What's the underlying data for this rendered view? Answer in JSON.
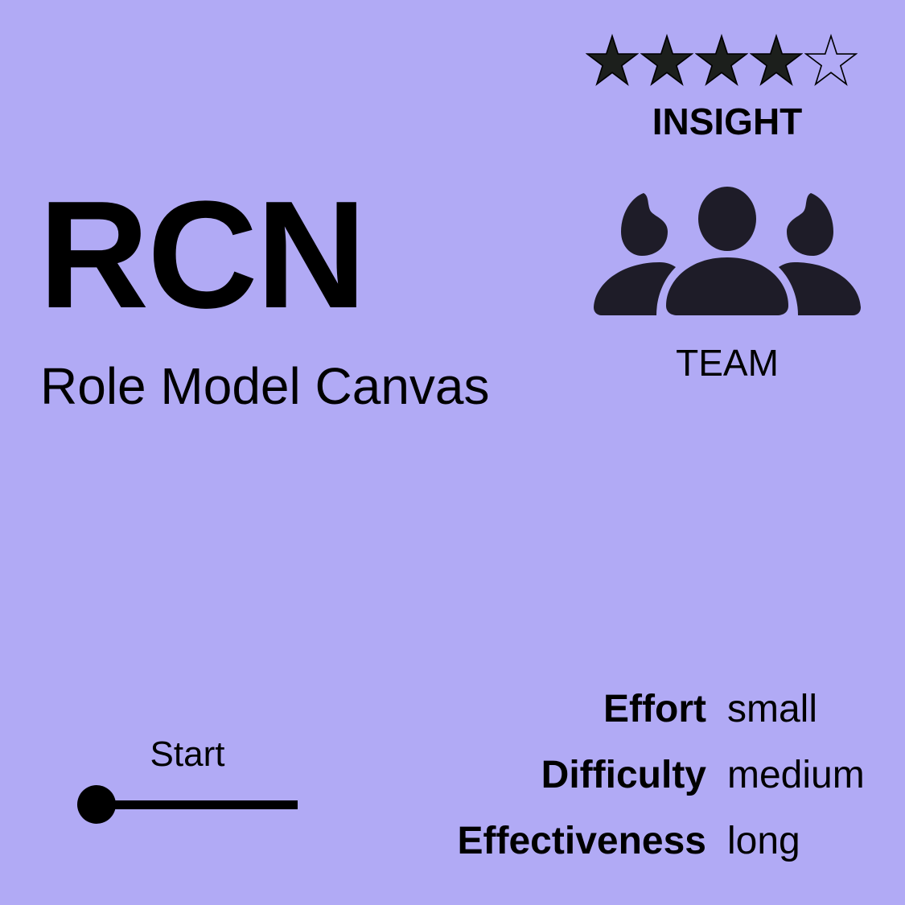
{
  "card": {
    "acronym": "RCN",
    "title": "Role Model Canvas",
    "background_color": "#b1aaf5"
  },
  "rating": {
    "value": 4,
    "max": 5,
    "filled_color": "#1c1f1c"
  },
  "category": {
    "label": "INSIGHT"
  },
  "team": {
    "icon": "team-icon",
    "label": "TEAM",
    "icon_color": "#1e1c28"
  },
  "timeline": {
    "label": "Start"
  },
  "metrics": [
    {
      "name": "Effort",
      "value": "small"
    },
    {
      "name": "Difficulty",
      "value": "medium"
    },
    {
      "name": "Effectiveness",
      "value": "long"
    }
  ]
}
